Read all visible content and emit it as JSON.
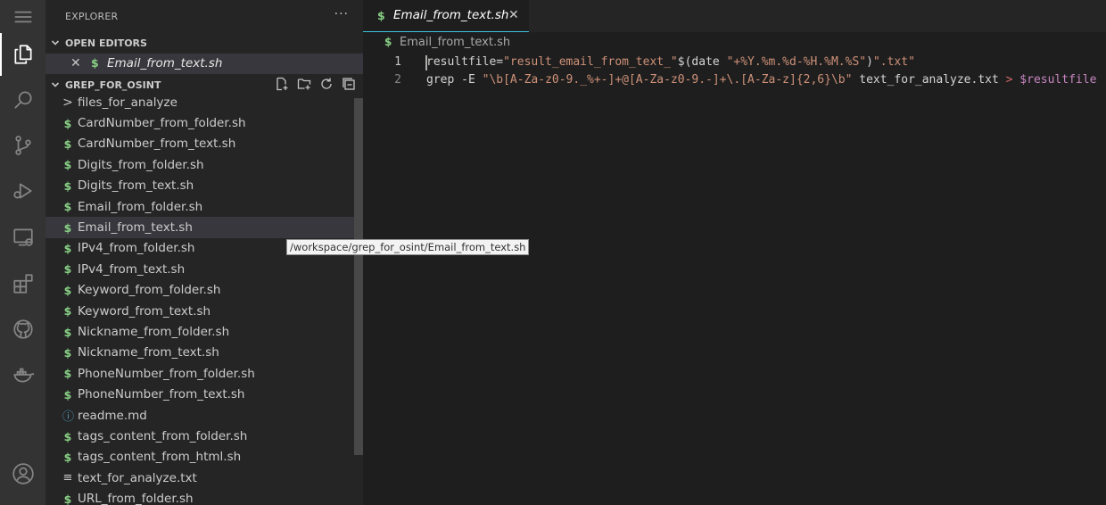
{
  "sidebar": {
    "title": "EXPLORER",
    "more_label": "···",
    "open_editors": {
      "header": "OPEN EDITORS",
      "items": [
        {
          "icon": "$",
          "name": "Email_from_text.sh"
        }
      ]
    },
    "folder": {
      "header": "GREP_FOR_OSINT",
      "items": [
        {
          "icon": ">",
          "name": "files_for_analyze",
          "kind": "folder"
        },
        {
          "icon": "$",
          "name": "CardNumber_from_folder.sh",
          "kind": "shell"
        },
        {
          "icon": "$",
          "name": "CardNumber_from_text.sh",
          "kind": "shell"
        },
        {
          "icon": "$",
          "name": "Digits_from_folder.sh",
          "kind": "shell"
        },
        {
          "icon": "$",
          "name": "Digits_from_text.sh",
          "kind": "shell"
        },
        {
          "icon": "$",
          "name": "Email_from_folder.sh",
          "kind": "shell"
        },
        {
          "icon": "$",
          "name": "Email_from_text.sh",
          "kind": "shell",
          "selected": true
        },
        {
          "icon": "$",
          "name": "IPv4_from_folder.sh",
          "kind": "shell"
        },
        {
          "icon": "$",
          "name": "IPv4_from_text.sh",
          "kind": "shell"
        },
        {
          "icon": "$",
          "name": "Keyword_from_folder.sh",
          "kind": "shell"
        },
        {
          "icon": "$",
          "name": "Keyword_from_text.sh",
          "kind": "shell"
        },
        {
          "icon": "$",
          "name": "Nickname_from_folder.sh",
          "kind": "shell"
        },
        {
          "icon": "$",
          "name": "Nickname_from_text.sh",
          "kind": "shell"
        },
        {
          "icon": "$",
          "name": "PhoneNumber_from_folder.sh",
          "kind": "shell"
        },
        {
          "icon": "$",
          "name": "PhoneNumber_from_text.sh",
          "kind": "shell"
        },
        {
          "icon": "ⓘ",
          "name": "readme.md",
          "kind": "info"
        },
        {
          "icon": "$",
          "name": "tags_content_from_folder.sh",
          "kind": "shell"
        },
        {
          "icon": "$",
          "name": "tags_content_from_html.sh",
          "kind": "shell"
        },
        {
          "icon": "≡",
          "name": "text_for_analyze.txt",
          "kind": "text"
        },
        {
          "icon": "$",
          "name": "URL_from_folder.sh",
          "kind": "shell"
        }
      ]
    }
  },
  "editor": {
    "tab": {
      "icon": "$",
      "label": "Email_from_text.sh",
      "close": "✕"
    },
    "breadcrumb": {
      "icon": "$",
      "label": "Email_from_text.sh"
    },
    "lines": [
      {
        "number": "1",
        "code": "resultfile=\"result_email_from_text_\"$(date \"+%Y.%m.%d-%H.%M.%S\")\".txt\""
      },
      {
        "number": "2",
        "code": "grep -E \"\\b[A-Za-z0-9._%+-]+@[A-Za-z0-9.-]+\\.[A-Za-z]{2,6}\\b\" text_for_analyze.txt > $resultfile"
      }
    ]
  },
  "tooltip": "/workspace/grep_for_osint/Email_from_text.sh",
  "colors": {
    "activity_bar": "#333333",
    "sidebar": "#252526",
    "editor": "#1e1e1e",
    "shell_icon": "#89d185",
    "tab_accent": "#3ec2dd",
    "string": "#ce9178"
  }
}
